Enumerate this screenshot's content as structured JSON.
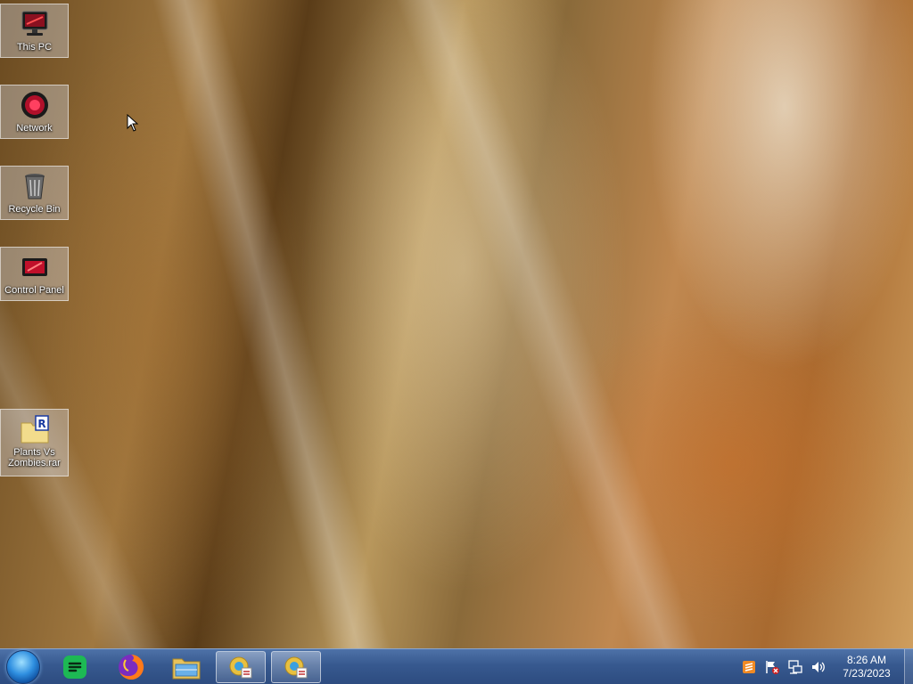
{
  "desktop": {
    "icons": [
      {
        "label": "This PC",
        "icon": "computer-monitor-icon"
      },
      {
        "label": "Network",
        "icon": "network-globe-icon"
      },
      {
        "label": "Recycle Bin",
        "icon": "recycle-bin-icon"
      },
      {
        "label": "Control Panel",
        "icon": "control-panel-icon"
      },
      {
        "label": "Plants Vs Zombies.rar",
        "icon": "rar-archive-icon"
      }
    ]
  },
  "taskbar": {
    "start_icon": "start-orb-icon",
    "pinned": [
      {
        "name": "Spotify-like app",
        "icon": "green-app-icon"
      },
      {
        "name": "Firefox",
        "icon": "firefox-icon"
      },
      {
        "name": "File Explorer",
        "icon": "folder-icon"
      }
    ],
    "running": [
      {
        "icon": "installer-icon"
      },
      {
        "icon": "installer-icon"
      }
    ],
    "tray": {
      "icons": [
        "sublime-icon",
        "flag-error-icon",
        "network-icon",
        "volume-icon"
      ],
      "time": "8:26 AM",
      "date": "7/23/2023"
    }
  },
  "colors": {
    "taskbar": "#37598f",
    "accent": "#2f8fe0"
  }
}
